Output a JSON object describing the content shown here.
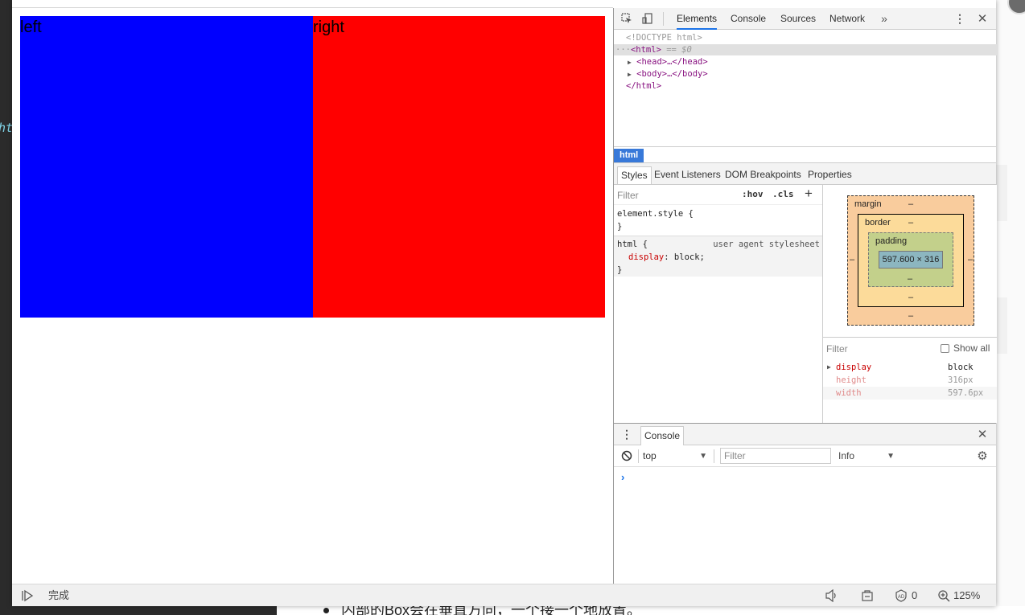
{
  "background": {
    "left_code_fragment": "ht",
    "bottom_text": "内部的Box会在垂直方向，一个接一个地放置。"
  },
  "page": {
    "left_box": {
      "label": "left",
      "color": "#0000ff"
    },
    "right_box": {
      "label": "right",
      "color": "#ff0000"
    }
  },
  "devtools": {
    "tabs": [
      "Elements",
      "Console",
      "Sources",
      "Network"
    ],
    "active_tab": "Elements",
    "more_tabs_icon": "double-chevron-right-icon",
    "dom": {
      "doctype": "<!DOCTYPE html>",
      "html_open": "<html>",
      "selected_suffix": "== $0",
      "head": "<head>…</head>",
      "body": "<body>…</body>",
      "html_close": "</html>"
    },
    "breadcrumb": "html",
    "sub_tabs": [
      "Styles",
      "Event Listeners",
      "DOM Breakpoints",
      "Properties"
    ],
    "styles": {
      "filter_placeholder": "Filter",
      "hov": ":hov",
      "cls": ".cls",
      "plus": "+",
      "element_style_open": "element.style {",
      "element_style_close": "}",
      "html_rule_open": "html {",
      "html_rule_source": "user agent stylesheet",
      "html_rule_prop": "display",
      "html_rule_value": "block;",
      "html_rule_close": "}"
    },
    "box_model": {
      "margin_label": "margin",
      "border_label": "border",
      "padding_label": "padding",
      "content_size": "597.600 × 316",
      "dash": "–"
    },
    "computed": {
      "filter_placeholder": "Filter",
      "show_all": "Show all",
      "rows": [
        {
          "name": "display",
          "value": "block"
        },
        {
          "name": "height",
          "value": "316px"
        },
        {
          "name": "width",
          "value": "597.6px"
        }
      ]
    },
    "console": {
      "tab": "Console",
      "context": "top",
      "filter_placeholder": "Filter",
      "level": "Info",
      "prompt": "›"
    }
  },
  "status_bar": {
    "status_text": "完成",
    "blocked_count": "0",
    "zoom": "125%"
  }
}
